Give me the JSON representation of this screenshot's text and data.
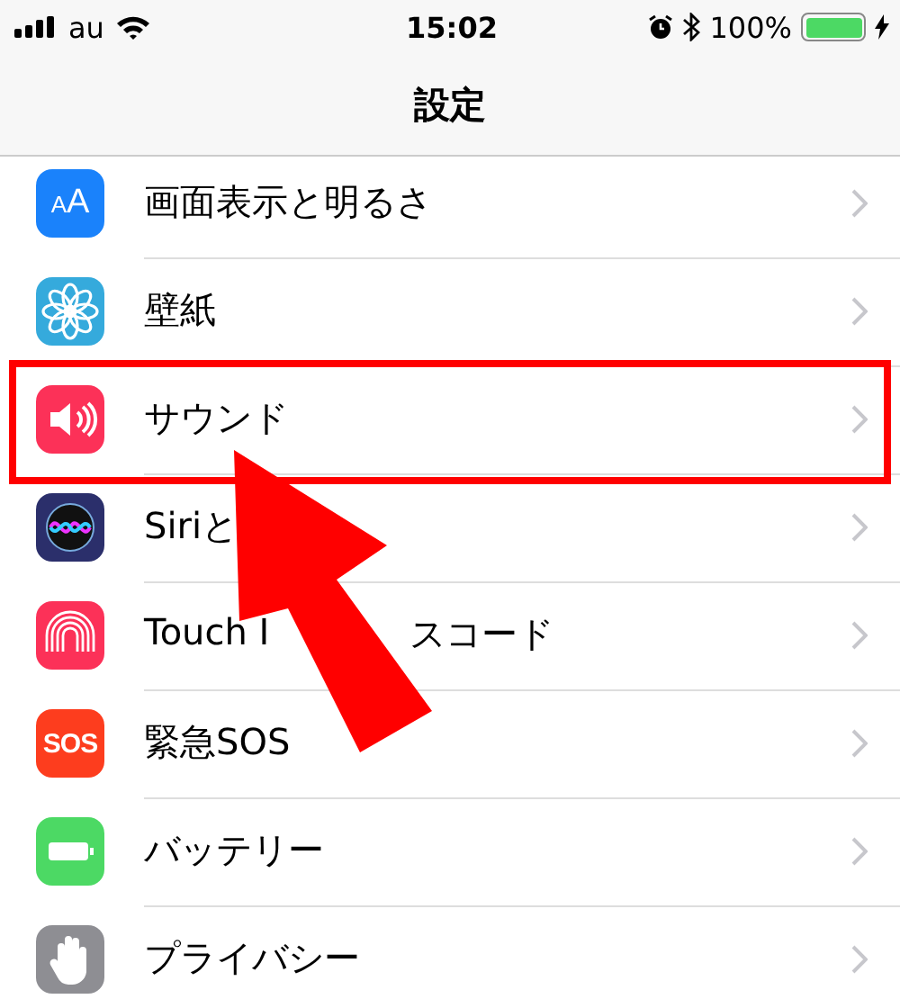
{
  "status_bar": {
    "carrier": "au",
    "time": "15:02",
    "battery_percent": "100%",
    "battery": {
      "level": 1
    }
  },
  "nav": {
    "title": "設定"
  },
  "rows": [
    {
      "kind": "text-size",
      "color": "#1a82fb",
      "icon_text": "AA",
      "label_parts": [
        "画面表示と明るさ"
      ],
      "highlighted": false
    },
    {
      "kind": "flower",
      "color": "#35aadc",
      "label_parts": [
        "壁紙"
      ],
      "highlighted": false
    },
    {
      "kind": "speaker",
      "color": "#fc3158",
      "label_parts": [
        "サウンド"
      ],
      "highlighted": true
    },
    {
      "kind": "siri",
      "color": "#2b2f6b",
      "label_parts": [
        "Siriと"
      ],
      "highlighted": false
    },
    {
      "kind": "fingerprint",
      "color": "#fc3158",
      "label_parts": [
        "Touch I",
        "スコード"
      ],
      "highlighted": false
    },
    {
      "kind": "sos",
      "color": "#fd3d1e",
      "icon_text": "SOS",
      "label_parts": [
        "緊急SOS"
      ],
      "highlighted": false
    },
    {
      "kind": "battery",
      "color": "#4cd964",
      "label_parts": [
        "バッテリー"
      ],
      "highlighted": false
    },
    {
      "kind": "hand",
      "color": "#8e8e93",
      "label_parts": [
        "プライバシー"
      ],
      "highlighted": false
    }
  ],
  "callout": {
    "kind": "arrow"
  }
}
